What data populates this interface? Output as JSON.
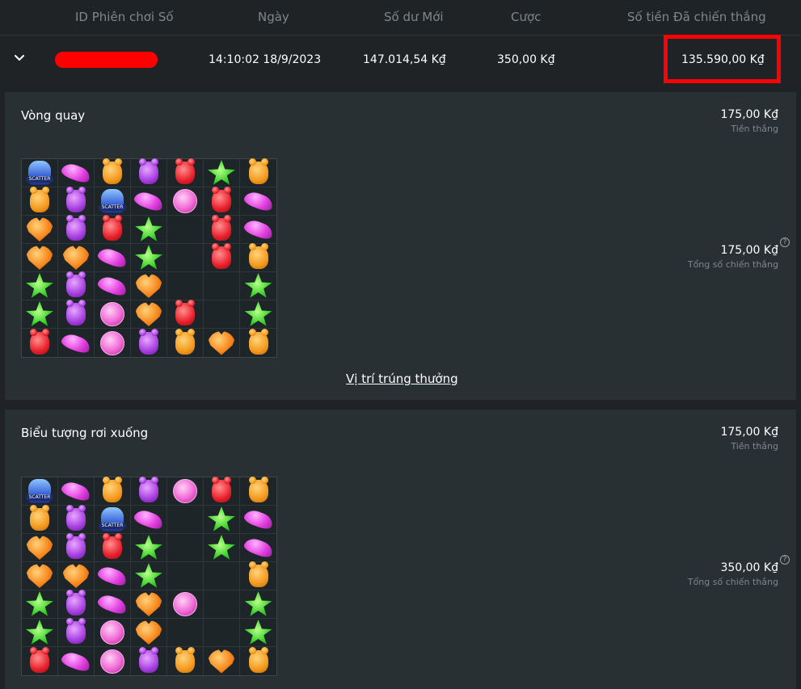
{
  "table_header": {
    "columns": [
      "ID Phiên chơi Số",
      "Ngày",
      "Số dư Mới",
      "Cược",
      "Số tiền Đã chiến thắng"
    ]
  },
  "row": {
    "date": "14:10:02 18/9/2023",
    "new_balance": "147.014,54 K₫",
    "bet": "350,00 K₫",
    "won_amount": "135.590,00 K₫",
    "expanded": true,
    "id_redacted": true
  },
  "panels": [
    {
      "title": "Vòng quay",
      "win_amount": "175,00 K₫",
      "win_label": "Tiền thắng",
      "total_amount": "175,00 K₫",
      "total_label": "Tổng số chiến thắng",
      "link_label": "Vị trí trúng thưởng",
      "grid": [
        [
          "scatter",
          "bean-pink",
          "bear-orange",
          "bear-purple",
          "bear-red",
          "star",
          "bear-orange"
        ],
        [
          "bear-orange",
          "bear-purple",
          "scatter",
          "bean-pink",
          "candy",
          "bear-red",
          "bean-pink"
        ],
        [
          "heart",
          "bear-purple",
          "bear-red",
          "star",
          "empty",
          "bear-red",
          "bean-pink"
        ],
        [
          "heart",
          "heart",
          "bean-pink",
          "star",
          "empty",
          "bear-red",
          "bear-orange"
        ],
        [
          "star",
          "bear-purple",
          "bean-pink",
          "heart",
          "empty",
          "empty",
          "star"
        ],
        [
          "star",
          "bear-purple",
          "candy",
          "heart",
          "bear-red",
          "empty",
          "star"
        ],
        [
          "bear-red",
          "bean-pink",
          "candy",
          "bear-purple",
          "bear-orange",
          "heart",
          "bear-orange"
        ]
      ]
    },
    {
      "title": "Biểu tượng rơi xuống",
      "win_amount": "175,00 K₫",
      "win_label": "Tiền thắng",
      "total_amount": "350,00 K₫",
      "total_label": "Tổng số chiến thắng",
      "grid": [
        [
          "scatter",
          "bean-pink",
          "bear-orange",
          "bear-purple",
          "candy",
          "bear-red",
          "bear-orange"
        ],
        [
          "bear-orange",
          "bear-purple",
          "scatter",
          "bean-pink",
          "empty",
          "star",
          "bean-pink"
        ],
        [
          "heart",
          "bear-purple",
          "bear-red",
          "star",
          "empty",
          "star",
          "bean-pink"
        ],
        [
          "heart",
          "heart",
          "bean-pink",
          "star",
          "empty",
          "empty",
          "bear-orange"
        ],
        [
          "star",
          "bear-purple",
          "bean-pink",
          "heart",
          "candy",
          "empty",
          "star"
        ],
        [
          "star",
          "bear-purple",
          "candy",
          "heart",
          "empty",
          "empty",
          "star"
        ],
        [
          "bear-red",
          "bean-pink",
          "candy",
          "bear-purple",
          "bear-orange",
          "heart",
          "bear-orange"
        ]
      ]
    }
  ],
  "colors": {
    "background": "#1f2326",
    "panel": "#283033",
    "highlight": "#ff0000",
    "muted_text": "#7e878d"
  }
}
